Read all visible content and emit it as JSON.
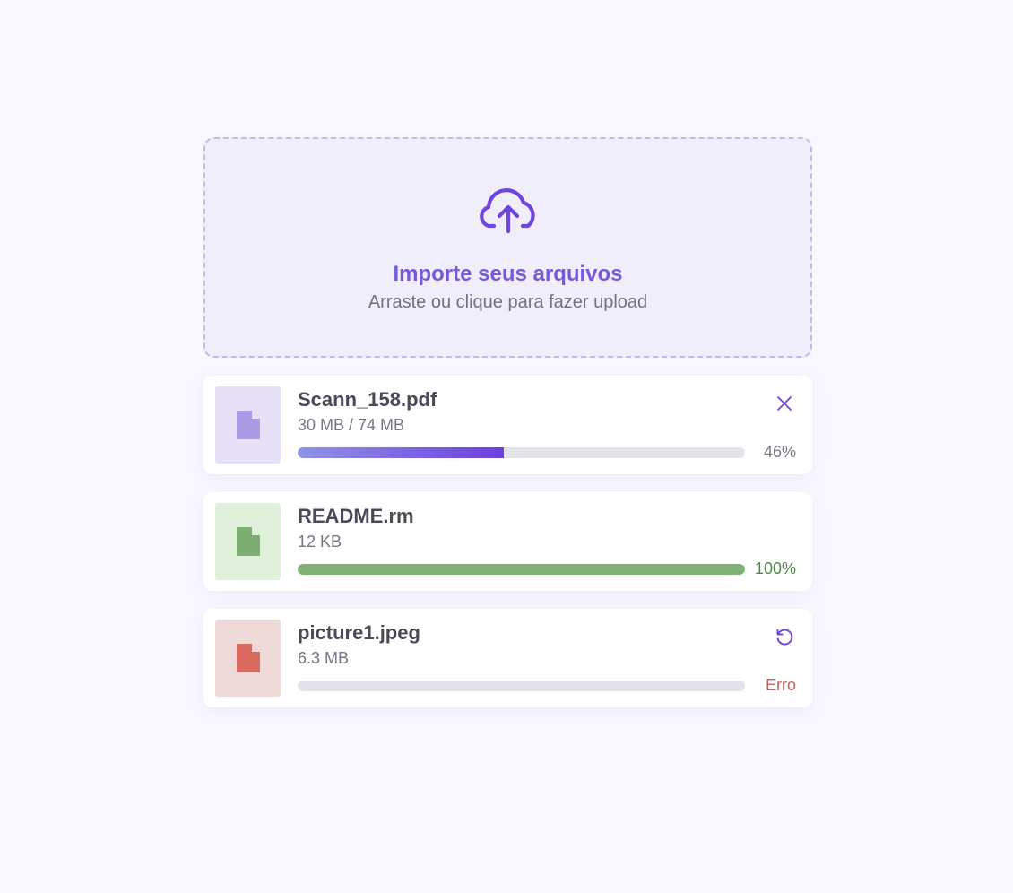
{
  "dropzone": {
    "icon": "cloud-upload-icon",
    "title": "Importe seus arquivos",
    "subtitle": "Arraste ou clique para fazer upload"
  },
  "files": [
    {
      "name": "Scann_158.pdf",
      "size": "30 MB / 74 MB",
      "progress": 0.46,
      "status": "46%",
      "action_icon": "close-icon",
      "colors": {
        "thumb_bg": "#e6e1f6",
        "icon": "#ad9ae6",
        "bar_start": "#8f93e4",
        "bar_end": "#6d3fe0",
        "status": "#7a7885"
      }
    },
    {
      "name": "README.rm",
      "size": "12 KB",
      "progress": 1.0,
      "status": "100%",
      "action_icon": "",
      "colors": {
        "thumb_bg": "#e0f0da",
        "icon": "#7daf72",
        "bar_start": "#80b176",
        "bar_end": "#80b176",
        "status": "#4f8a45"
      }
    },
    {
      "name": "picture1.jpeg",
      "size": "6.3 MB",
      "progress": 0,
      "status": "Erro",
      "action_icon": "retry-icon",
      "colors": {
        "thumb_bg": "#efdada",
        "icon": "#d86a60",
        "bar_start": "#e4e3ea",
        "bar_end": "#e4e3ea",
        "status": "#cf5d56"
      }
    }
  ],
  "colors": {
    "accent": "#7044de",
    "background": "#f9f8fe",
    "dropzone_bg": "#f1eefb",
    "dropzone_border": "#c3b9ec"
  }
}
